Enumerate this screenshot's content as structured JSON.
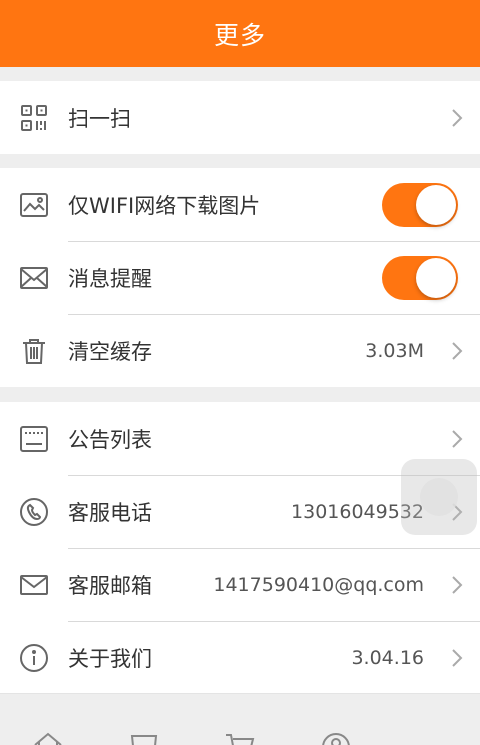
{
  "header": {
    "title": "更多"
  },
  "sections": [
    {
      "items": [
        {
          "label": "扫一扫",
          "icon": "qr-code-icon"
        }
      ]
    },
    {
      "items": [
        {
          "label": "仅WIFI网络下载图片",
          "icon": "image-icon",
          "toggle": true
        },
        {
          "label": "消息提醒",
          "icon": "mail-icon",
          "toggle": true
        },
        {
          "label": "清空缓存",
          "icon": "trash-icon",
          "value": "3.03M"
        }
      ]
    },
    {
      "items": [
        {
          "label": "公告列表",
          "icon": "notice-board-icon"
        },
        {
          "label": "客服电话",
          "icon": "phone-icon",
          "value": "13016049532"
        },
        {
          "label": "客服邮箱",
          "icon": "envelope-icon",
          "value": "1417590410@qq.com"
        },
        {
          "label": "关于我们",
          "icon": "info-icon",
          "value": "3.04.16"
        }
      ]
    }
  ],
  "colors": {
    "accent": "#ff7511",
    "background": "#eeeeee",
    "divider": "#d9d9d9"
  },
  "tabbar": {
    "icons": [
      "home-icon",
      "category-icon",
      "cart-icon",
      "user-icon"
    ]
  }
}
